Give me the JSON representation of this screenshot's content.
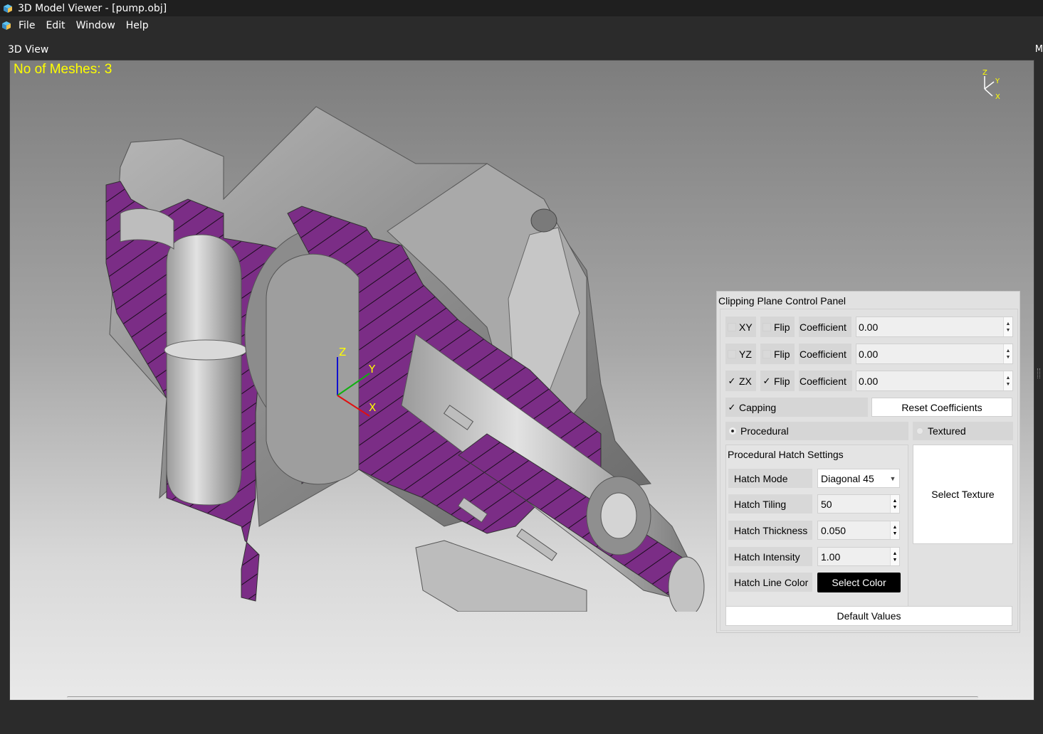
{
  "window": {
    "title": "3D Model Viewer - [pump.obj]"
  },
  "menu": {
    "items": [
      "File",
      "Edit",
      "Window",
      "Help"
    ]
  },
  "view": {
    "title": "3D View",
    "right_edge_text": "M",
    "mesh_count_text": "No of Meshes: 3"
  },
  "axes": {
    "z": "Z",
    "y": "Y",
    "x": "X"
  },
  "panel": {
    "title": "Clipping Plane Control Panel",
    "planes": [
      {
        "plane": "XY",
        "plane_checked": false,
        "flip": "Flip",
        "flip_checked": false,
        "coef_label": "Coefficient",
        "coef_value": "0.00"
      },
      {
        "plane": "YZ",
        "plane_checked": false,
        "flip": "Flip",
        "flip_checked": false,
        "coef_label": "Coefficient",
        "coef_value": "0.00"
      },
      {
        "plane": "ZX",
        "plane_checked": true,
        "flip": "Flip",
        "flip_checked": true,
        "coef_label": "Coefficient",
        "coef_value": "0.00"
      }
    ],
    "capping": {
      "label": "Capping",
      "checked": true
    },
    "reset_label": "Reset Coefficients",
    "procedural": {
      "label": "Procedural",
      "selected": true
    },
    "textured": {
      "label": "Textured",
      "selected": false
    },
    "hatch": {
      "title": "Procedural Hatch Settings",
      "mode_label": "Hatch Mode",
      "mode_value": "Diagonal 45",
      "tiling_label": "Hatch Tiling",
      "tiling_value": "50",
      "thickness_label": "Hatch Thickness",
      "thickness_value": "0.050",
      "intensity_label": "Hatch Intensity",
      "intensity_value": "1.00",
      "color_label": "Hatch Line Color",
      "color_button": "Select Color"
    },
    "texture_button": "Select Texture",
    "default_button": "Default Values"
  },
  "colors": {
    "mesh_count": "#ffff00",
    "hatch_fill": "#7b2d86",
    "viewport_top": "#7d7d7d",
    "viewport_bottom": "#e9e9e9"
  }
}
